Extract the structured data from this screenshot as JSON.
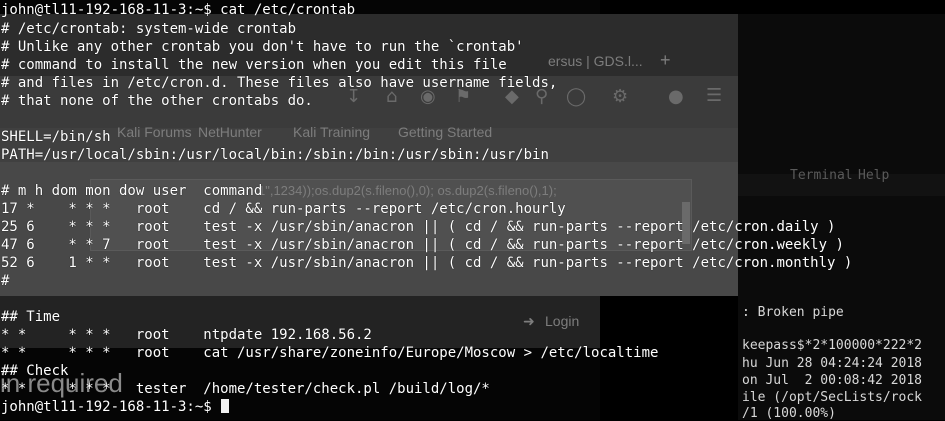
{
  "terminal": {
    "lines": [
      "john@tl11-192-168-11-3:~$ cat /etc/crontab",
      "# /etc/crontab: system-wide crontab",
      "# Unlike any other crontab you don't have to run the `crontab'",
      "# command to install the new version when you edit this file",
      "# and files in /etc/cron.d. These files also have username fields,",
      "# that none of the other crontabs do.",
      "",
      "SHELL=/bin/sh",
      "PATH=/usr/local/sbin:/usr/local/bin:/sbin:/bin:/usr/sbin:/usr/bin",
      "",
      "# m h dom mon dow user  command",
      "17 *    * * *   root    cd / && run-parts --report /etc/cron.hourly",
      "25 6    * * *   root    test -x /usr/sbin/anacron || ( cd / && run-parts --report /etc/cron.daily )",
      "47 6    * * 7   root    test -x /usr/sbin/anacron || ( cd / && run-parts --report /etc/cron.weekly )",
      "52 6    1 * *   root    test -x /usr/sbin/anacron || ( cd / && run-parts --report /etc/cron.monthly )",
      "#",
      "",
      "## Time",
      "* *     * * *   root    ntpdate 192.168.56.2",
      "* *     * * *   root    cat /usr/share/zoneinfo/Europe/Moscow > /etc/localtime",
      "## Check",
      "* *     * * *   tester  /home/tester/check.pl /build/log/*",
      "john@tl11-192-168-11-3:~$ "
    ]
  },
  "background": {
    "browser_tab": "ersus | GDS.l...",
    "browser_new_tab": "+",
    "bookmarks": [
      "Kali Forums",
      "NetHunter",
      "Kali Training",
      "Getting Started"
    ],
    "code_snippet": "1\",1234));os.dup2(s.fileno(),0); os.dup2(s.fileno(),1);",
    "login_label": "Login",
    "page_text": "in required",
    "right_terminal": {
      "menu": [
        "Terminal",
        "Help"
      ],
      "broken_pipe": ": Broken pipe",
      "lines": [
        "keepass$*2*100000*222*2",
        "hu Jun 28 04:24:24 2018",
        "on Jul  2 00:08:42 2018",
        "ile (/opt/SecLists/rock",
        "/1 (100.00%)"
      ]
    }
  }
}
